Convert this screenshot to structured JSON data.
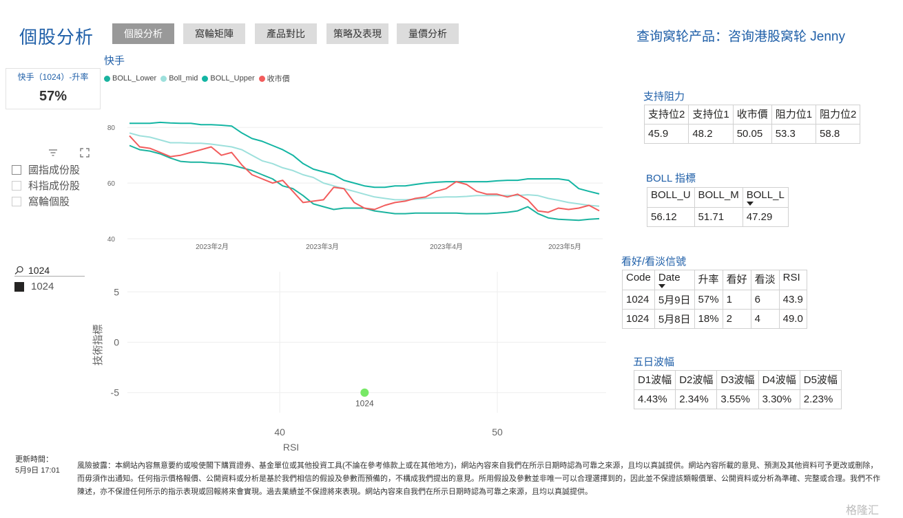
{
  "header": {
    "title": "個股分析",
    "tabs": [
      "個股分析",
      "窩輪矩陣",
      "產品對比",
      "策略及表現",
      "量價分析"
    ],
    "active_tab": "個股分析",
    "top_link": "查询窝轮产品：咨询港股窝轮 Jenny"
  },
  "stock_name": "快手",
  "kpi_card": {
    "label": "快手（1024）-升率",
    "value": "57%"
  },
  "filters": {
    "options": [
      "國指成份股",
      "科指成份股",
      "窩輪個股"
    ],
    "search_value": "1024",
    "selected_item": "1024"
  },
  "colors": {
    "lower": "#1ab39f",
    "mid": "#9de0dc",
    "upper": "#13b5a3",
    "close": "#f25c5c",
    "accent": "#1f5fa8",
    "point": "#77e866"
  },
  "chart_data": [
    {
      "type": "line",
      "title": "快手",
      "x_ticks": [
        "2023年2月",
        "2023年3月",
        "2023年4月",
        "2023年5月"
      ],
      "ylim": [
        40,
        85
      ],
      "y_ticks": [
        40,
        60,
        80
      ],
      "legend_position": "top-left",
      "series": [
        {
          "name": "BOLL_Lower",
          "values": [
            73.5,
            72,
            71.5,
            70.5,
            69,
            67.8,
            67.5,
            67.5,
            67.2,
            67,
            66.5,
            65.5,
            64.5,
            63,
            61.5,
            59,
            58,
            55.5,
            52.5,
            51.5,
            50.5,
            51,
            51,
            51,
            50,
            49.5,
            49,
            49,
            49.2,
            49.2,
            49.2,
            49.2,
            49.2,
            49,
            49,
            49,
            49.2,
            49.5,
            50,
            51.5,
            49,
            47.5,
            47,
            46.8,
            46.6,
            47,
            47.2
          ]
        },
        {
          "name": "Boll_mid",
          "values": [
            78,
            77,
            76.5,
            75.5,
            74.5,
            74.5,
            74.3,
            74.3,
            74,
            73.5,
            73,
            72,
            70,
            68,
            67,
            65.5,
            64.5,
            63,
            62,
            60,
            59,
            58,
            57,
            56,
            55,
            54.5,
            54,
            54,
            54.2,
            54.5,
            54.8,
            55,
            55,
            55.2,
            55.5,
            55.5,
            55.5,
            55.5,
            55.5,
            55.8,
            55.5,
            54.5,
            53.8,
            53,
            52.5,
            52,
            51.7
          ]
        },
        {
          "name": "BOLL_Upper",
          "values": [
            81.5,
            81.5,
            81.5,
            81.8,
            81.6,
            81.5,
            81.5,
            81,
            81,
            80.8,
            80.5,
            78,
            76,
            75,
            73.5,
            72,
            70,
            67,
            65,
            64,
            63,
            61,
            60,
            59,
            58.5,
            58.5,
            59,
            59,
            59.5,
            60,
            60.3,
            60.5,
            60.5,
            60.5,
            60.5,
            60.5,
            60.8,
            61,
            61,
            61.5,
            61.5,
            61.5,
            61.5,
            61,
            58,
            57,
            56.1
          ]
        },
        {
          "name": "收市價",
          "values": [
            77,
            73,
            72.5,
            71,
            69.5,
            70,
            71,
            72,
            73,
            70,
            71,
            66.5,
            63,
            61.5,
            60,
            61,
            57,
            53,
            53.5,
            54,
            58.5,
            58,
            53,
            51,
            50.5,
            52,
            53,
            53.5,
            54.5,
            55,
            57,
            58,
            60.5,
            59.5,
            57,
            56,
            56,
            55,
            56,
            54,
            50,
            49.5,
            51,
            50.5,
            51,
            52,
            50.05
          ]
        }
      ]
    },
    {
      "type": "scatter",
      "xlabel": "RSI",
      "ylabel": "技術指標",
      "x_ticks": [
        40,
        50
      ],
      "y_ticks": [
        5,
        0,
        -5
      ],
      "xlim": [
        33,
        55
      ],
      "ylim": [
        -7,
        7
      ],
      "points": [
        {
          "x": 43.9,
          "y": -5,
          "label": "1024"
        }
      ]
    }
  ],
  "support_resistance": {
    "title": "支持阻力",
    "headers": [
      "支持位2",
      "支持位1",
      "收市價",
      "阻力位1",
      "阻力位2"
    ],
    "values": [
      "45.9",
      "48.2",
      "50.05",
      "53.3",
      "58.8"
    ]
  },
  "boll": {
    "title": "BOLL 指標",
    "headers": [
      "BOLL_U",
      "BOLL_M",
      "BOLL_L"
    ],
    "values": [
      "56.12",
      "51.71",
      "47.29"
    ]
  },
  "signals": {
    "title": "看好/看淡信號",
    "headers": [
      "Code",
      "Date",
      "升率",
      "看好",
      "看淡",
      "RSI"
    ],
    "rows": [
      [
        "1024",
        "5月9日",
        "57%",
        "1",
        "6",
        "43.9"
      ],
      [
        "1024",
        "5月8日",
        "18%",
        "2",
        "4",
        "49.0"
      ]
    ]
  },
  "volatility": {
    "title": "五日波幅",
    "headers": [
      "D1波幅",
      "D2波幅",
      "D3波幅",
      "D4波幅",
      "D5波幅"
    ],
    "values": [
      "4.43%",
      "2.34%",
      "3.55%",
      "3.30%",
      "2.23%"
    ]
  },
  "footer": {
    "updated_label": "更新時間：",
    "updated_value": "5月9日 17:01",
    "disclaimer": "風險披露：本網站內容無意要約或唆使閣下購買證券、基金單位或其他投資工具(不論在參考條款上或在其他地方)，網站內容來自我們在所示日期時認為可靠之來源，且均以真誠提供。網站內容所載的意見、預測及其他資料可予更改或刪除，而毋須作出通知。任何指示價格報價、公開資料或分析是基於我們相信的假設及參數而預備的，不構成我們提出的意見。所用假設及參數並非唯一可以合理選擇到的，因此並不保證該類報價單、公開資料或分析為準確、完整或合理。我們不作陳述，亦不保證任何所示的指示表現或回報將來會實現。過去業績並不保證將來表現。網站內容來自我們在所示日期時認為可靠之來源，且均以真誠提供。",
    "watermark": "格隆汇"
  }
}
